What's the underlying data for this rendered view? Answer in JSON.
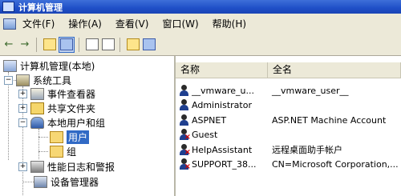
{
  "window": {
    "title": "计算机管理"
  },
  "menubar": {
    "items": [
      "文件(F)",
      "操作(A)",
      "查看(V)",
      "窗口(W)",
      "帮助(H)"
    ]
  },
  "toolbar": {
    "back": "←",
    "forward": "→"
  },
  "tree": {
    "root": "计算机管理(本地)",
    "system_tools": "系统工具",
    "event_viewer": "事件查看器",
    "shared_folders": "共享文件夹",
    "local_users_groups": "本地用户和组",
    "users": "用户",
    "groups": "组",
    "perf_logs": "性能日志和警报",
    "device_manager": "设备管理器",
    "expand_minus": "−",
    "expand_plus": "+"
  },
  "list": {
    "columns": [
      "名称",
      "全名"
    ],
    "rows": [
      {
        "name": "__vmware_u...",
        "full": "__vmware_user__",
        "disabled": false
      },
      {
        "name": "Administrator",
        "full": "",
        "disabled": false
      },
      {
        "name": "ASPNET",
        "full": "ASP.NET Machine Account",
        "disabled": false
      },
      {
        "name": "Guest",
        "full": "",
        "disabled": true
      },
      {
        "name": "HelpAssistant",
        "full": "远程桌面助手帐户",
        "disabled": true
      },
      {
        "name": "SUPPORT_38...",
        "full": "CN=Microsoft Corporation,...",
        "disabled": true
      }
    ]
  }
}
